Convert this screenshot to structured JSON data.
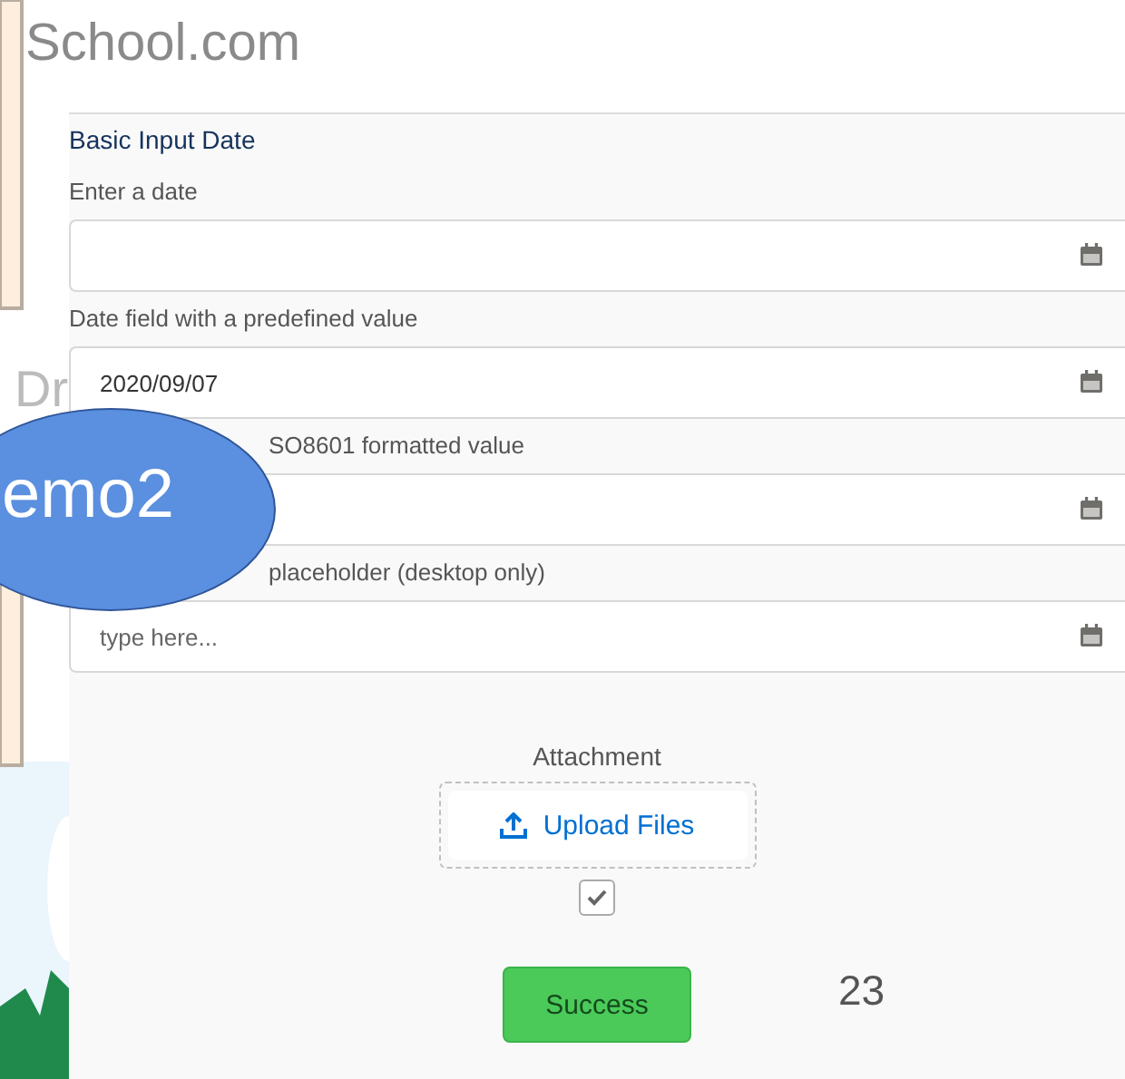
{
  "slide": {
    "title": "School.com",
    "subtitle": "Dr",
    "callout": "emo2",
    "page_number": "23"
  },
  "form": {
    "title": "Basic Input Date",
    "fields": [
      {
        "label": "Enter a date",
        "partly_hidden": false
      },
      {
        "label": "Date field with a predefined value",
        "value": "2020/09/07",
        "partly_hidden": false
      },
      {
        "label": "SO8601 formatted value",
        "partly_hidden": true
      },
      {
        "label": "placeholder (desktop only)",
        "placeholder": "type here...",
        "partly_hidden": true
      }
    ],
    "attachment": {
      "label": "Attachment",
      "button": "Upload Files",
      "checked": true
    },
    "submit": "Success"
  }
}
